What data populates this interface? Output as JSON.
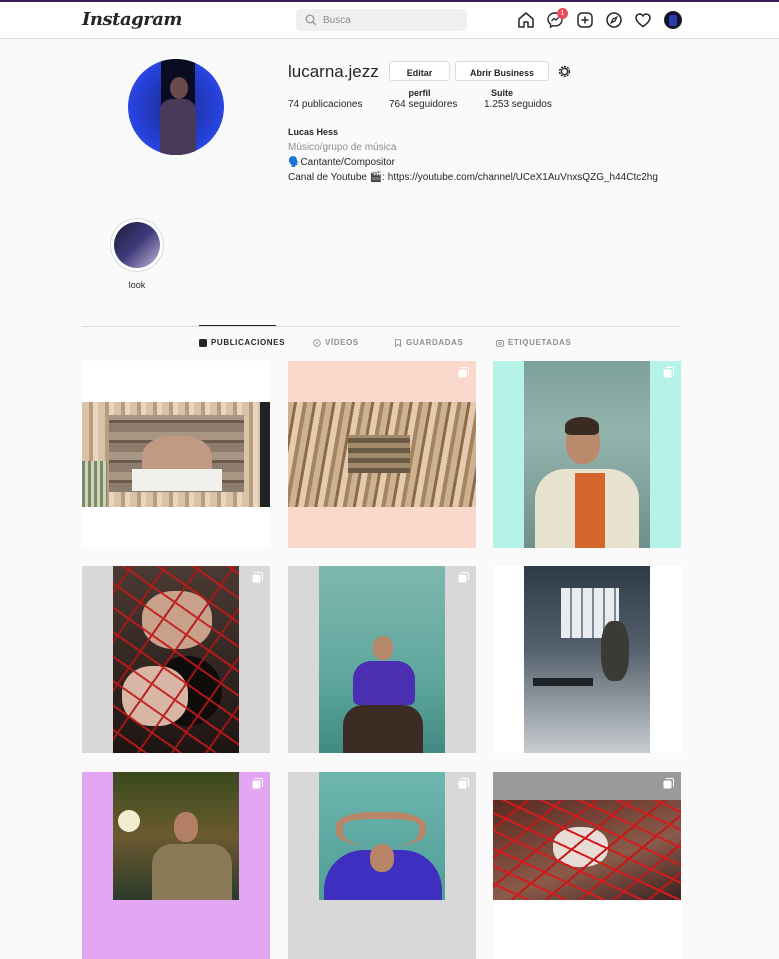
{
  "navbar": {
    "logo": "Instagram",
    "search_placeholder": "Busca",
    "messages_badge": "1",
    "icons": [
      "home-icon",
      "messenger-icon",
      "new-post-icon",
      "explore-icon",
      "activity-heart-icon",
      "profile-avatar"
    ]
  },
  "profile": {
    "username": "lucarna.jezz",
    "edit_button": "Editar perfil",
    "business_button": "Abrir Business Suite",
    "stats": {
      "posts": "74 publicaciones",
      "followers": "764 seguidores",
      "following": "1.253 seguidos"
    },
    "bio": {
      "name": "Lucas Hess",
      "category": "Músico/grupo de música",
      "line1": "🗣️Cantante/Compositor",
      "line2": "Canal de Youtube 🎬: https://youtube.com/channel/UCeX1AuVnxsQZG_h44Ctc2hg"
    }
  },
  "highlights": [
    {
      "label": "look"
    }
  ],
  "tabs": [
    {
      "label": "PUBLICACIONES",
      "icon": "grid-icon",
      "active": true
    },
    {
      "label": "VÍDEOS",
      "icon": "video-icon",
      "active": false
    },
    {
      "label": "GUARDADAS",
      "icon": "bookmark-icon",
      "active": false
    },
    {
      "label": "ETIQUETADAS",
      "icon": "tagged-icon",
      "active": false
    }
  ],
  "posts": [
    {
      "multi": false
    },
    {
      "multi": true
    },
    {
      "multi": true
    },
    {
      "multi": true
    },
    {
      "multi": true
    },
    {
      "multi": false
    },
    {
      "multi": true
    },
    {
      "multi": true
    },
    {
      "multi": true
    }
  ],
  "colors": {
    "accent_border": "#dbdbdb",
    "badge": "#ed4956",
    "text_primary": "#262626",
    "text_secondary": "#8e8e8e"
  }
}
